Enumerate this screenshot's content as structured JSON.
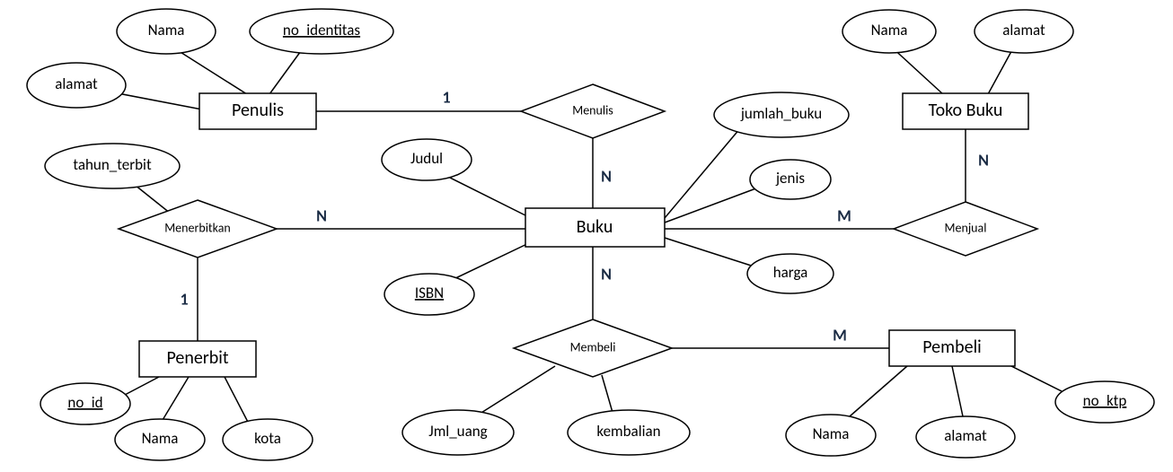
{
  "entities": {
    "penulis": "Penulis",
    "penerbit": "Penerbit",
    "buku": "Buku",
    "toko_buku": "Toko Buku",
    "pembeli": "Pembeli"
  },
  "relationships": {
    "menulis": "Menulis",
    "menerbitkan": "Menerbitkan",
    "menjual": "Menjual",
    "membeli": "Membeli"
  },
  "attributes": {
    "penulis": {
      "nama": "Nama",
      "no_identitas": "no_identitas",
      "alamat": "alamat"
    },
    "penerbit": {
      "no_id": "no_id",
      "nama": "Nama",
      "kota": "kota"
    },
    "buku": {
      "judul": "Judul",
      "isbn": "ISBN",
      "jumlah_buku": "jumlah_buku",
      "jenis": "jenis",
      "harga": "harga"
    },
    "toko_buku": {
      "nama": "Nama",
      "alamat": "alamat"
    },
    "pembeli": {
      "nama": "Nama",
      "alamat": "alamat",
      "no_ktp": "no_ktp"
    },
    "menerbitkan": {
      "tahun_terbit": "tahun_terbit"
    },
    "membeli": {
      "jml_uang": "Jml_uang",
      "kembalian": "kembalian"
    }
  },
  "cardinalities": {
    "menulis_penulis": "1",
    "menulis_buku": "N",
    "menerbitkan_buku": "N",
    "menerbitkan_penerbit": "1",
    "menjual_buku": "M",
    "menjual_toko": "N",
    "membeli_buku": "N",
    "membeli_pembeli": "M"
  }
}
